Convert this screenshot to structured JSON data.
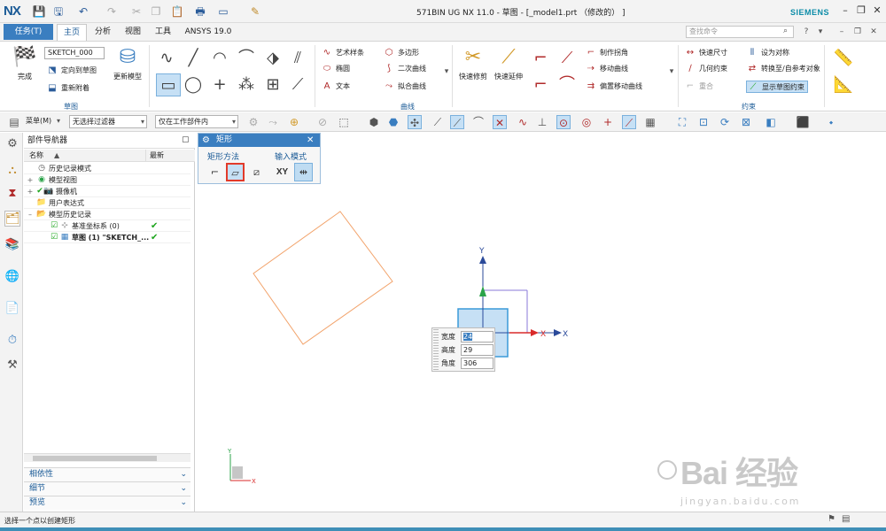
{
  "window": {
    "logo": "NX",
    "title": "571BIN UG NX 11.0 - 草图 - [_model1.prt （修改的） ]",
    "brand": "SIEMENS"
  },
  "tabs": {
    "task": "任务(T)",
    "items": [
      "主页",
      "分析",
      "视图",
      "工具",
      "ANSYS 19.0"
    ],
    "search_placeholder": "查找命令"
  },
  "ribbon": {
    "sketch_group": {
      "label": "草图",
      "finish": "完成",
      "sketch_name": "SKETCH_000",
      "orient": "定向到草图",
      "reattach": "重新附着",
      "update_model": "更新模型"
    },
    "curve_group": {
      "label": "曲线",
      "art_spline": "艺术样条",
      "polygon": "多边形",
      "ellipse": "椭圆",
      "conic": "二次曲线",
      "text": "文本",
      "fit_curve": "拟合曲线",
      "quick_trim": "快速修剪",
      "quick_extend": "快速延伸",
      "make_corner": "制作拐角",
      "move_curve": "移动曲线",
      "offset_move": "偏置移动曲线"
    },
    "constraint_group": {
      "label": "约束",
      "quick_dim": "快速尺寸",
      "geo_constraint": "几何约束",
      "coincident": "重合",
      "set_symmetric": "设为对称",
      "convert_ref": "转换至/自参考对象",
      "show_constraints": "显示草图约束"
    }
  },
  "cmdbar": {
    "menu": "菜单(M)",
    "filter": "无选择过滤器",
    "scope": "仅在工作部件内"
  },
  "navigator": {
    "title": "部件导航器",
    "col_name": "名称",
    "col_latest": "最新",
    "rows": [
      {
        "label": "历史记录模式",
        "latest": ""
      },
      {
        "label": "模型视图",
        "latest": ""
      },
      {
        "label": "摄像机",
        "latest": ""
      },
      {
        "label": "用户表达式",
        "latest": ""
      },
      {
        "label": "模型历史记录",
        "latest": ""
      },
      {
        "label": "基准坐标系 (0)",
        "latest": "✔"
      },
      {
        "label": "草图 (1) \"SKETCH_...",
        "latest": "✔"
      }
    ],
    "panels": [
      "相依性",
      "细节",
      "预览"
    ]
  },
  "dialog": {
    "title": "矩形",
    "method_label": "矩形方法",
    "input_label": "输入模式",
    "xy": "XY"
  },
  "dynamic_input": {
    "width_label": "宽度",
    "width": "24",
    "height_label": "高度",
    "height": "29",
    "angle_label": "角度",
    "angle": "306"
  },
  "axes": {
    "x": "X",
    "y": "Y"
  },
  "status": "选择一个点以创建矩形",
  "watermark": {
    "main": "Bai 经验",
    "sub": "jingyan.baidu.com"
  },
  "colors": {
    "accent": "#3a7ec0",
    "rect_preview": "#f2a36b",
    "highlight_border": "#e23a2a"
  }
}
